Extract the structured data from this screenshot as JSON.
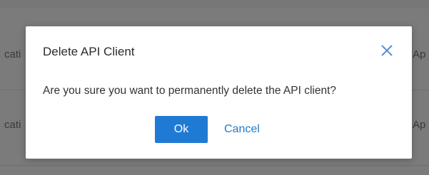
{
  "background": {
    "left_fragments": [
      "cati",
      "cati"
    ],
    "right_fragments": [
      "Ap",
      "Ap"
    ]
  },
  "dialog": {
    "title": "Delete API Client",
    "message": "Are you sure you want to permanently delete the API client?",
    "close_icon": "close-icon",
    "ok_label": "Ok",
    "cancel_label": "Cancel"
  },
  "colors": {
    "primary": "#1f7ad3",
    "overlay": "#7b7b7b",
    "close_icon": "#5b8fd3"
  }
}
